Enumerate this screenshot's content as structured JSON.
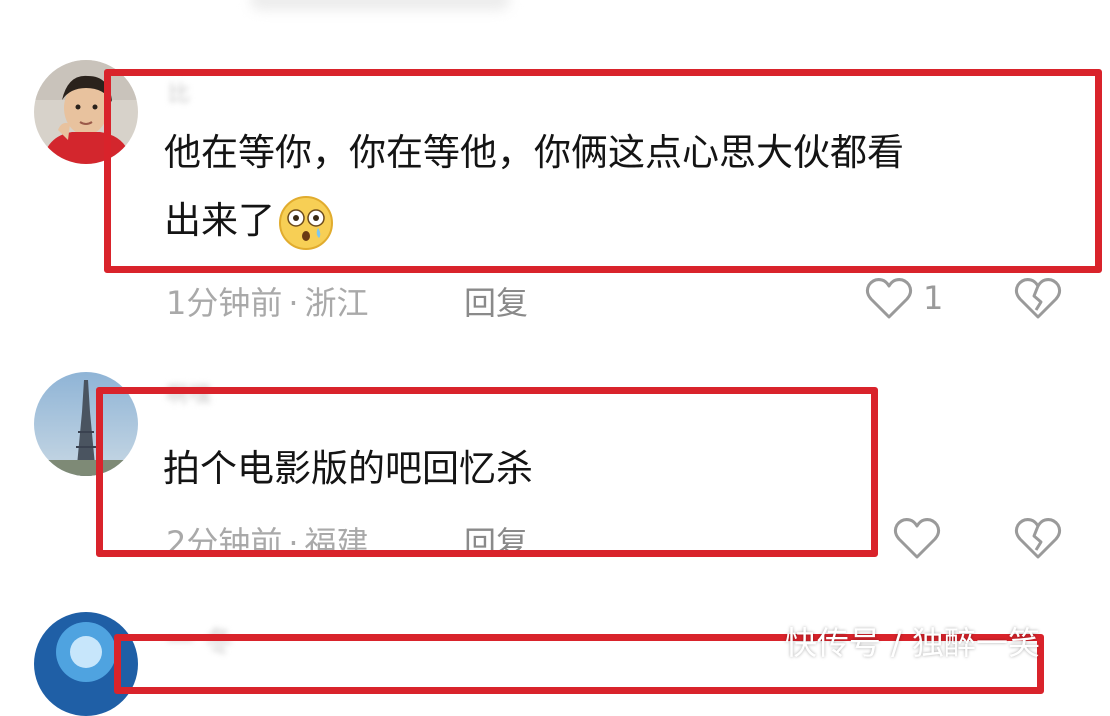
{
  "comments": [
    {
      "username": "比",
      "text_line1": "他在等你，你在等他，你俩这点心思大伙都看",
      "text_line2": "出来了",
      "time": "1分钟前",
      "separator": "·",
      "location": "浙江",
      "reply_label": "回复",
      "like_count": "1",
      "emoji": "astonished-face-emoji"
    },
    {
      "username": "啊嘿",
      "text": "拍个电影版的吧回忆杀",
      "time": "2分钟前",
      "separator": "·",
      "location": "福建",
      "reply_label": "回复",
      "like_count": ""
    },
    {
      "username": "一 冬",
      "text": ""
    }
  ],
  "watermark": "快传号 / 独醉一笑",
  "colors": {
    "highlight": "#d9232b",
    "meta_text": "#a9a9a9",
    "body_text": "#141414"
  },
  "icons": {
    "like": "heart-outline-icon",
    "dislike": "broken-heart-icon"
  }
}
